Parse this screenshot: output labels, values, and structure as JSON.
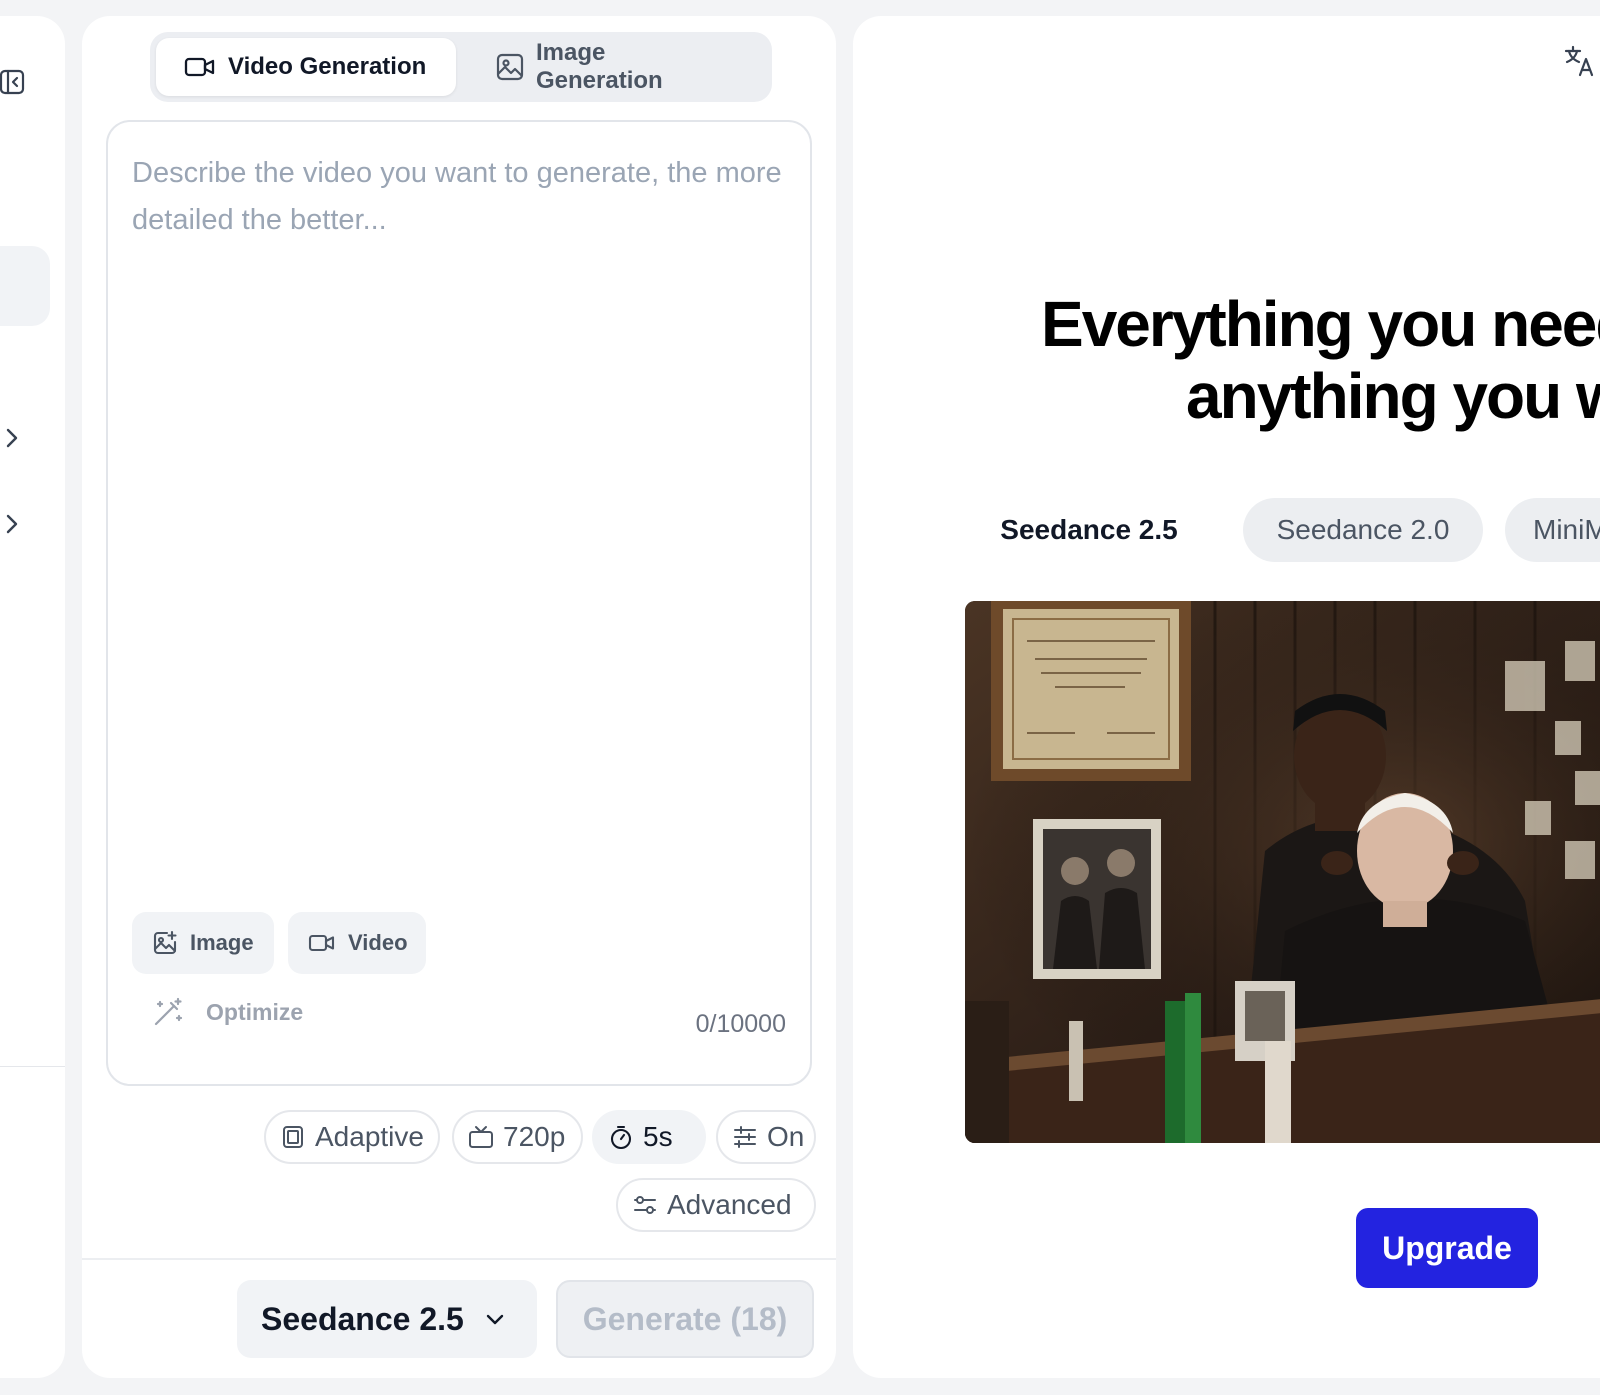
{
  "tabs": {
    "video_label": "Video Generation",
    "image_label": "Image Generation"
  },
  "prompt": {
    "value": "",
    "placeholder": "Describe the video you want to generate, the more detailed the better...",
    "char_count": "0/10000",
    "attach_image_label": "Image",
    "attach_video_label": "Video",
    "optimize_label": "Optimize"
  },
  "options": {
    "ratio": "Adaptive",
    "resolution": "720p",
    "duration": "5s",
    "audio": "On",
    "advanced": "Advanced"
  },
  "footer": {
    "model": "Seedance 2.5",
    "generate_label": "Generate (18)"
  },
  "preview": {
    "title_line1": "Everything you need",
    "title_line2": "anything you w",
    "model_tabs": [
      "Seedance 2.5",
      "Seedance 2.0",
      "MiniM"
    ],
    "active_model_tab": 0,
    "upgrade_label": "Upgrade"
  },
  "colors": {
    "accent": "#2323e0",
    "page_bg": "#f3f4f6",
    "panel_bg": "#ffffff",
    "chip_bg": "#f1f3f6",
    "muted_text": "#9aa5b4"
  },
  "icons": {
    "rail_collapse": "sidebar-collapse-icon",
    "rail_chevrons": "chevron-right-icon",
    "video_tab": "video-camera-icon",
    "image_tab": "image-icon",
    "attach_image": "image-plus-icon",
    "attach_video": "video-camera-icon",
    "optimize": "magic-wand-icon",
    "ratio": "aspect-ratio-icon",
    "resolution": "tv-icon",
    "duration": "stopwatch-icon",
    "audio": "sliders-icon",
    "advanced": "settings-toggle-icon",
    "model_dropdown": "chevron-down-icon",
    "translate": "translate-icon"
  }
}
